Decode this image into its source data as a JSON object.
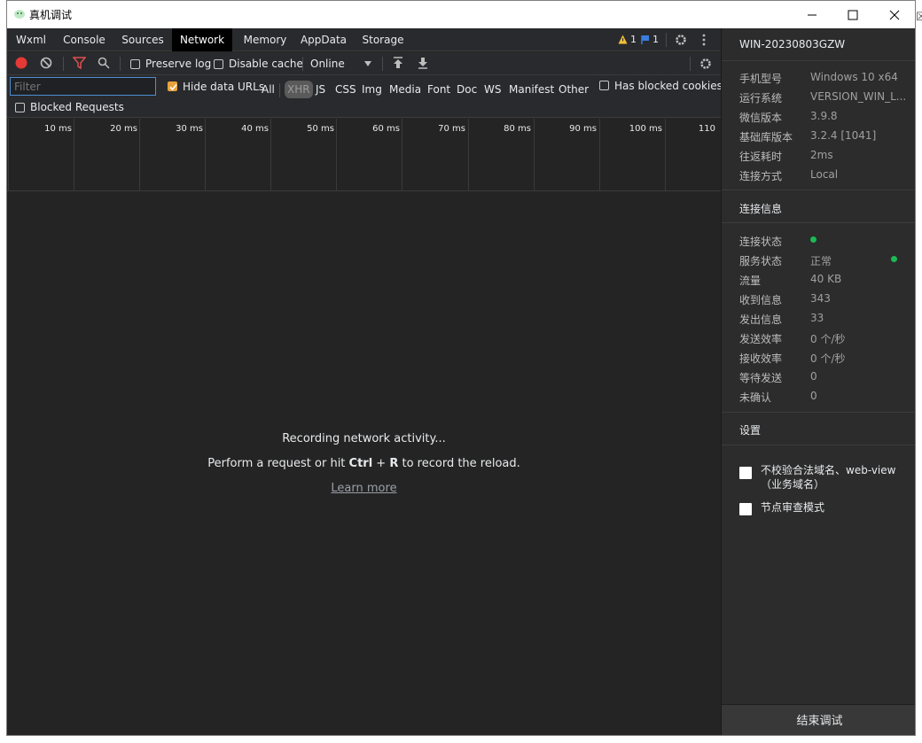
{
  "window": {
    "title": "真机调试"
  },
  "background_fragment": "区",
  "tabs": [
    {
      "label": "Wxml"
    },
    {
      "label": "Console"
    },
    {
      "label": "Sources"
    },
    {
      "label": "Network",
      "active": true
    },
    {
      "label": "Memory"
    },
    {
      "label": "AppData"
    },
    {
      "label": "Storage"
    }
  ],
  "badges": {
    "warnings": "1",
    "info": "1"
  },
  "toolbar": {
    "preserve_log": "Preserve log",
    "disable_cache": "Disable cache",
    "throttle": "Online"
  },
  "filterbar": {
    "filter_placeholder": "Filter",
    "hide_data_urls": "Hide data URLs",
    "types": [
      "All",
      "XHR",
      "JS",
      "CSS",
      "Img",
      "Media",
      "Font",
      "Doc",
      "WS",
      "Manifest",
      "Other"
    ],
    "selected_type": "XHR",
    "has_blocked_cookies": "Has blocked cookies",
    "blocked_requests": "Blocked Requests"
  },
  "timeline": {
    "ticks": [
      "10 ms",
      "20 ms",
      "30 ms",
      "40 ms",
      "50 ms",
      "60 ms",
      "70 ms",
      "80 ms",
      "90 ms",
      "100 ms",
      "110"
    ]
  },
  "empty": {
    "recording": "Recording network activity...",
    "hint_prefix": "Perform a request or hit ",
    "hint_key1": "Ctrl",
    "hint_plus": " + ",
    "hint_key2": "R",
    "hint_suffix": " to record the reload.",
    "learn_more": "Learn more"
  },
  "side": {
    "device": "WIN-20230803GZW",
    "info": [
      {
        "k": "手机型号",
        "v": "Windows 10 x64"
      },
      {
        "k": "运行系统",
        "v": "VERSION_WIN_L..."
      },
      {
        "k": "微信版本",
        "v": "3.9.8"
      },
      {
        "k": "基础库版本",
        "v": "3.2.4 [1041]"
      },
      {
        "k": "往返耗时",
        "v": "2ms"
      },
      {
        "k": "连接方式",
        "v": "Local"
      }
    ],
    "conn_title": "连接信息",
    "conn": [
      {
        "k": "连接状态",
        "v": ""
      },
      {
        "k": "服务状态",
        "v": "正常"
      },
      {
        "k": "流量",
        "v": "40 KB"
      },
      {
        "k": "收到信息",
        "v": "343"
      },
      {
        "k": "发出信息",
        "v": "33"
      },
      {
        "k": "发送效率",
        "v": "0 个/秒"
      },
      {
        "k": "接收效率",
        "v": "0 个/秒"
      },
      {
        "k": "等待发送",
        "v": "0"
      },
      {
        "k": "未确认",
        "v": "0"
      }
    ],
    "settings_title": "设置",
    "settings": [
      {
        "label": "不校验合法域名、web-view（业务域名）"
      },
      {
        "label": "节点审查模式"
      }
    ],
    "end_button": "结束调试"
  },
  "colors": {
    "record": "#e53935",
    "filter_icon": "#e05050",
    "status_dot": "#1db954",
    "accent_check": "#e8a23c"
  }
}
